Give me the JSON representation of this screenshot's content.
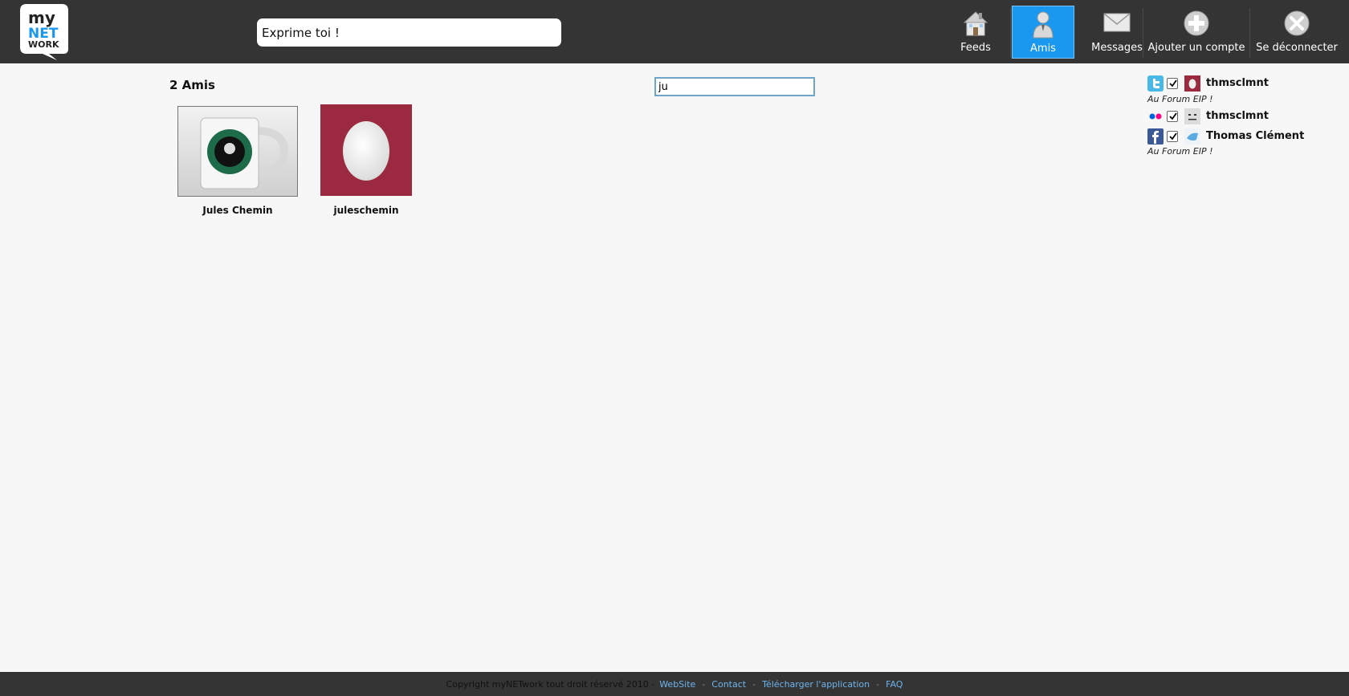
{
  "header": {
    "logo_text": [
      "my",
      "NET",
      "WORK"
    ],
    "post_placeholder": "Exprime toi !",
    "nav": [
      {
        "label": "Feeds",
        "icon": "home-icon"
      },
      {
        "label": "Amis",
        "icon": "friend-icon"
      },
      {
        "label": "Messages",
        "icon": "mail-icon"
      },
      {
        "label": "Ajouter un compte",
        "icon": "add-icon"
      },
      {
        "label": "Se déconnecter",
        "icon": "close-icon"
      }
    ]
  },
  "main": {
    "friends_count": "2 Amis",
    "search_value": "ju",
    "friends": [
      {
        "name": "Jules Chemin"
      },
      {
        "name": "juleschemin"
      }
    ]
  },
  "accounts": [
    {
      "service": "twitter",
      "name": "thmsclmnt",
      "status": "Au Forum EIP !"
    },
    {
      "service": "flickr",
      "name": "thmsclmnt"
    },
    {
      "service": "facebook",
      "name": "Thomas Clément",
      "status": "Au Forum EIP !"
    }
  ],
  "footer": {
    "copyright": "Copyright myNETwork tout droit réservé 2010 -",
    "links": [
      "WebSite",
      "Contact",
      "Télécharger l'application",
      "FAQ"
    ]
  },
  "colors": {
    "header_bg": "#343434",
    "accent_blue": "#1a98ef",
    "page_bg": "#f7f7f7",
    "egg_bg": "#9b2a40"
  }
}
